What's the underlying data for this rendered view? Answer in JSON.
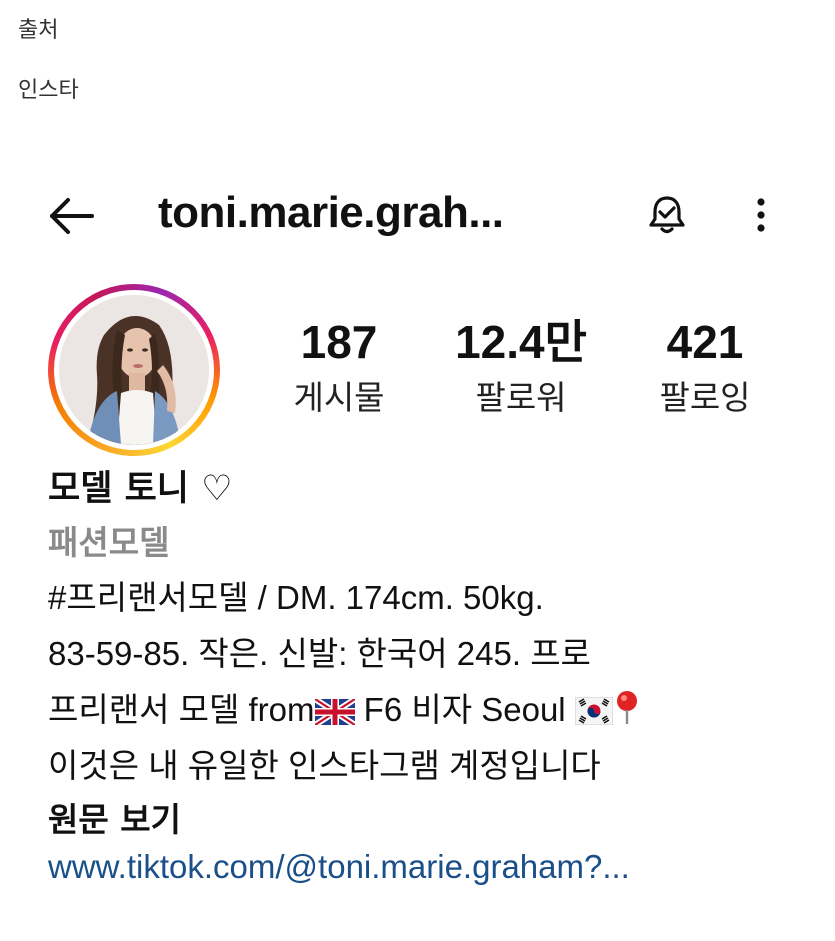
{
  "post_meta": {
    "source_label": "출처",
    "source_value": "인스타"
  },
  "profile": {
    "username": "toni.marie.grah...",
    "stats": {
      "posts_count": "187",
      "posts_label": "게시물",
      "followers_count": "12.4만",
      "followers_label": "팔로워",
      "following_count": "421",
      "following_label": "팔로잉"
    },
    "display_name": "모델 토니 ♡",
    "category": "패션모델",
    "bio": {
      "line1": "#프리랜서모델 / DM. 174cm. 50kg.",
      "line2": "83-59-85. 작은. 신발: 한국어 245. 프로",
      "line3_before": "프리랜서 모델 from",
      "line3_after": " F6 비자 Seoul ",
      "line4": "이것은 내 유일한 인스타그램 계정입니다"
    },
    "see_original_label": "원문 보기",
    "website": "www.tiktok.com/@toni.marie.graham?..."
  },
  "icons": {
    "back": "back-arrow-icon",
    "bell": "bell-check-icon",
    "more": "more-vertical-icon",
    "uk_flag": "uk-flag-icon",
    "kr_flag": "korea-flag-icon",
    "pin": "location-pin-icon"
  },
  "colors": {
    "link": "#1a4f8a",
    "category": "#8a8a8a",
    "ring_start": "#f9a825",
    "ring_end": "#c2185b"
  }
}
